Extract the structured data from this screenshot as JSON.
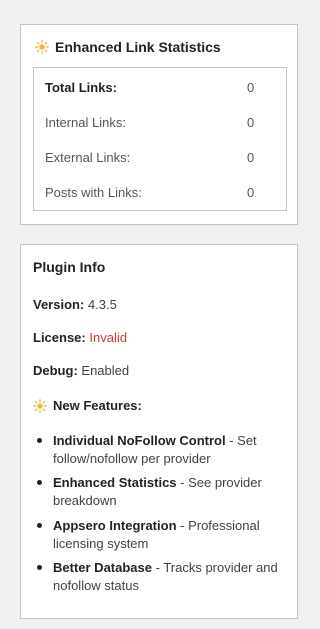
{
  "stats": {
    "title": "Enhanced Link Statistics",
    "rows": [
      {
        "label": "Total Links:",
        "value": "0"
      },
      {
        "label": "Internal Links:",
        "value": "0"
      },
      {
        "label": "External Links:",
        "value": "0"
      },
      {
        "label": "Posts with Links:",
        "value": "0"
      }
    ]
  },
  "info": {
    "title": "Plugin Info",
    "version_label": "Version:",
    "version_value": "4.3.5",
    "license_label": "License:",
    "license_value": "Invalid",
    "debug_label": "Debug:",
    "debug_value": "Enabled",
    "features_title": "New Features:",
    "features": [
      {
        "name": "Individual NoFollow Control",
        "desc": " - Set follow/nofollow per provider"
      },
      {
        "name": "Enhanced Statistics",
        "desc": " - See provider breakdown"
      },
      {
        "name": "Appsero Integration",
        "desc": " - Professional licensing system"
      },
      {
        "name": "Better Database",
        "desc": " - Tracks provider and nofollow status"
      }
    ]
  },
  "colors": {
    "invalid": "#d63638",
    "sun_icon": "#f0b849"
  },
  "icons": {
    "stats_title_icon": "sun-icon",
    "features_icon": "sun-icon"
  }
}
